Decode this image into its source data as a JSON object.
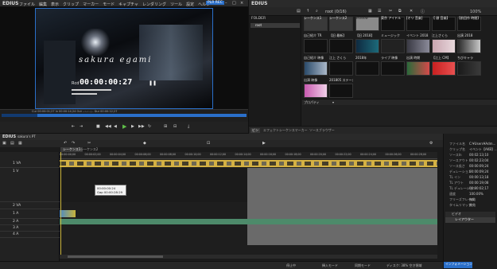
{
  "app": {
    "name": "EDIUS",
    "badge": "PLR REC",
    "window_controls": [
      "–",
      "□",
      "×"
    ]
  },
  "menu": [
    "ファイル",
    "編集",
    "表示",
    "クリップ",
    "マーカー",
    "モード",
    "キャプチャ",
    "レンダリング",
    "ツール",
    "設定",
    "ヘルプ"
  ],
  "player": {
    "overlay_name": "sakura egami",
    "rec_label": "Rcd",
    "timecode": "00:00:00:27",
    "status": "Cur 00:00:01;27 In 00:00:14;24 Out --:--:--;-- Dur 00:00:12;27"
  },
  "bin": {
    "title": "EDIUS",
    "folder_header": "FOLDER",
    "root_item": "root",
    "path": "root (0/16)",
    "zoom": "100%",
    "props_tab": "プロパティ",
    "bottom_tabs": [
      "ビン",
      "エフェクト",
      "シーケンスマーカー",
      "ソースブラウザー"
    ],
    "clips": [
      {
        "label": "シーケンス1"
      },
      {
        "label": "シーケンス2"
      },
      {
        "label": "Shadow"
      },
      {
        "label": "東京 アイドル"
      },
      {
        "label": "[オリ 音楽]"
      },
      {
        "label": "【 顔 音楽】"
      },
      {
        "label": "【前回作 時間】"
      },
      {
        "label": "自己紹介 TR"
      },
      {
        "label": "【旧 最新】"
      },
      {
        "label": "【旧 2018】"
      },
      {
        "label": "ミュージック"
      },
      {
        "label": "イベント 2018"
      },
      {
        "label": "江上さくら"
      },
      {
        "label": "出演 2018"
      },
      {
        "label": "自己紹介 映像"
      },
      {
        "label": "江上 さくら"
      },
      {
        "label": "2018年"
      },
      {
        "label": "ライブ 映像"
      },
      {
        "label": "出演 時期"
      },
      {
        "label": "【江上 CM】"
      },
      {
        "label": "ちびキャラ"
      },
      {
        "label": "出演 映像"
      },
      {
        "label": "201805 ステージ"
      }
    ]
  },
  "timeline": {
    "project": "sakura's PT",
    "seq_tabs": [
      "シーケンス1",
      "シーケンス2"
    ],
    "ticks": [
      "00:00:00;00",
      "00:00:02;00",
      "00:00:04;00",
      "00:00:06;00",
      "00:00:08;00",
      "00:00:10;00",
      "00:00:12;00",
      "00:00:14;00",
      "00:00:16;00",
      "00:00:18;00",
      "00:00:20;00",
      "00:00:22;00",
      "00:00:24;00",
      "00:00:26;00",
      "00:00:28;00"
    ],
    "tracks": [
      "1 VA",
      "1 V",
      "2 VA",
      "1 A",
      "2 A",
      "3 A",
      "4 A"
    ],
    "tooltip": [
      "00:00:00:24",
      "Gap 00:00:28:29"
    ],
    "status": [
      "停止中",
      "挿入モード",
      "同期モード",
      "ディスク: 38% 空き領域"
    ]
  },
  "props": {
    "rows": [
      {
        "k": "ファイル名",
        "v": "C:¥Users¥Adm..."
      },
      {
        "k": "クリップ名",
        "v": "イベント【AKB】..."
      },
      {
        "k": "ソースIn",
        "v": "00:02:13;10"
      },
      {
        "k": "ソースアウト",
        "v": "00:02:23;04"
      },
      {
        "k": "ソース長さ",
        "v": "00:00:09;24"
      },
      {
        "k": "デュレーション",
        "v": "00:00:09;24"
      },
      {
        "k": "TL イン",
        "v": "00:00:13;18"
      },
      {
        "k": "TL アウト",
        "v": "00:00:19;08"
      },
      {
        "k": "TL デュレーション",
        "v": "00:00:02;17"
      },
      {
        "k": "速度",
        "v": "100.00%"
      },
      {
        "k": "フリーズフレーム",
        "v": "無効"
      },
      {
        "k": "タイムリマップ",
        "v": "無効"
      }
    ],
    "section": "ビデオ",
    "effect": "レイアウター",
    "info_tab": "インフォメーション"
  },
  "colors": {
    "accent": "#2a6fc9",
    "clip_yellow": "#d4b143",
    "audio_green": "#4d8a6a",
    "playhead": "#c8b238"
  }
}
